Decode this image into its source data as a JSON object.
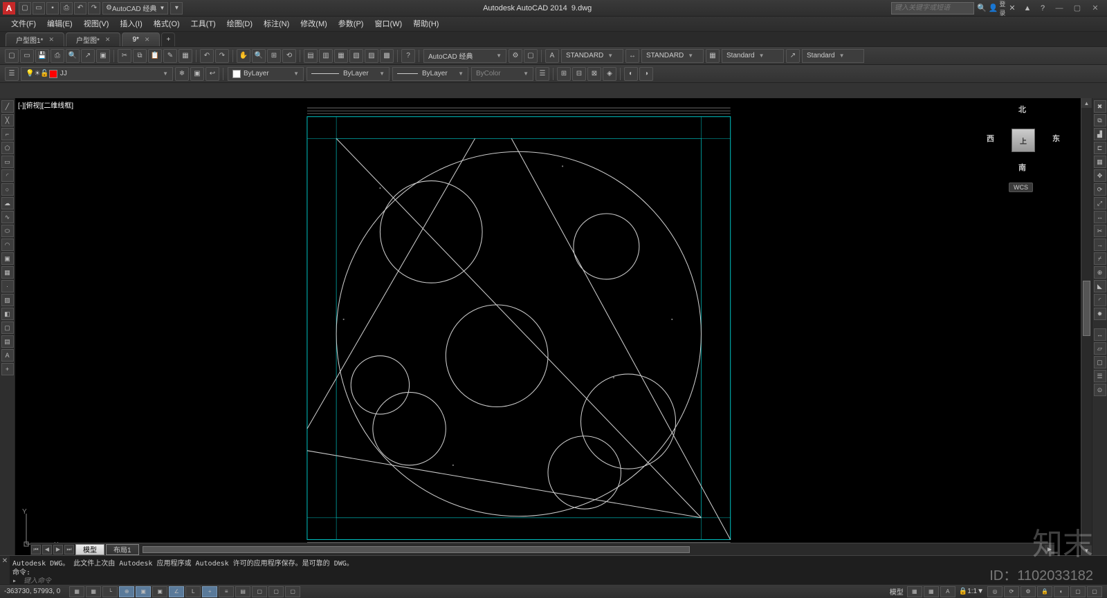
{
  "titlebar": {
    "app_name": "Autodesk AutoCAD 2014",
    "doc_name": "9.dwg",
    "workspace_dd": "AutoCAD 经典",
    "search_placeholder": "键入关键字或短语",
    "login_label": "登录"
  },
  "menus": [
    "文件(F)",
    "编辑(E)",
    "视图(V)",
    "插入(I)",
    "格式(O)",
    "工具(T)",
    "绘图(D)",
    "标注(N)",
    "修改(M)",
    "参数(P)",
    "窗口(W)",
    "帮助(H)"
  ],
  "doc_tabs": [
    {
      "label": "户型图1*",
      "active": false
    },
    {
      "label": "户型图*",
      "active": false
    },
    {
      "label": "9*",
      "active": true
    }
  ],
  "toolbar1": {
    "workspace_dd": "AutoCAD 经典",
    "textstyle": "STANDARD",
    "dimstyle": "STANDARD",
    "tablestyle": "Standard",
    "mleaderstyle": "Standard"
  },
  "toolbar2": {
    "layer_dd": "JJ",
    "layer_prop": "ByLayer",
    "linetype": "ByLayer",
    "lineweight": "ByLayer",
    "plotstyle": "ByColor"
  },
  "viewport": {
    "label": "[-][俯视][二维线框]",
    "cube": {
      "n": "北",
      "s": "南",
      "e": "东",
      "w": "西",
      "top": "上",
      "wcs": "WCS"
    },
    "ucs": {
      "x": "X",
      "y": "Y"
    }
  },
  "layout_tabs": {
    "model": "模型",
    "layout1": "布局1"
  },
  "cmd": {
    "history": "Autodesk DWG。 此文件上次由 Autodesk 应用程序或 Autodesk 许可的应用程序保存。是可靠的 DWG。",
    "prompt": "命令:",
    "placeholder": "键入命令"
  },
  "status": {
    "coords": "-363730, 57993, 0",
    "model": "模型",
    "scale": "1:1"
  },
  "watermark": {
    "brand": "知末",
    "id": "ID：1102033182"
  }
}
